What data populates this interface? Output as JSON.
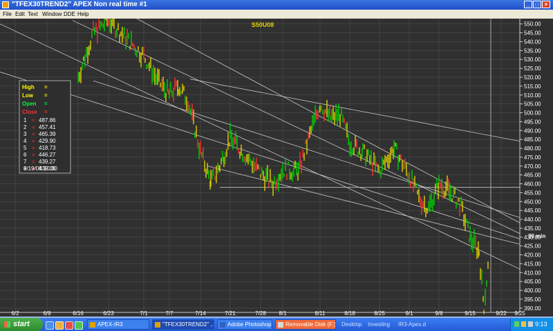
{
  "window": {
    "title": "\"TFEX30TREND2\" APEX Non real time #1"
  },
  "menu": [
    "File",
    "Edit",
    "Text",
    "Window",
    "DDE",
    "Help"
  ],
  "chart": {
    "symbol": "S50U08",
    "period_label": "30 min",
    "y_ticks": [
      390,
      395,
      400,
      405,
      410,
      415,
      420,
      425,
      430,
      435,
      440,
      445,
      450,
      455,
      460,
      465,
      470,
      475,
      480,
      485,
      490,
      495,
      500,
      505,
      510,
      515,
      520,
      525,
      530,
      535,
      540,
      545,
      550
    ],
    "x_labels": [
      "6/2",
      "6/9",
      "6/16",
      "6/23",
      "7/1",
      "7/7",
      "7/14",
      "7/21",
      "7/28",
      "8/1",
      "8/11",
      "8/18",
      "8/25",
      "9/1",
      "9/8",
      "9/15",
      "9/22",
      "9/25"
    ],
    "info_box": {
      "rows": [
        {
          "label": "High",
          "value": "=",
          "color": "#ffff00"
        },
        {
          "label": "Low",
          "value": "=",
          "color": "#ffff00"
        },
        {
          "label": "Open",
          "value": "=",
          "color": "#00ff40"
        },
        {
          "label": "Close",
          "value": "=",
          "color": "#ff3030"
        }
      ],
      "lines": [
        {
          "n": "1",
          "value": "487.86"
        },
        {
          "n": "2",
          "value": "457.41"
        },
        {
          "n": "3",
          "value": "465.39"
        },
        {
          "n": "4",
          "value": "429.90"
        },
        {
          "n": "5",
          "value": "418.73"
        },
        {
          "n": "6",
          "value": "446.27"
        },
        {
          "n": "7",
          "value": "439.27"
        },
        {
          "n": "8",
          "value": "439.28"
        }
      ],
      "timestamp": "9/19/08  10:30"
    },
    "colors": {
      "background": "#303030",
      "grid": "#555555",
      "bar_up": "#00d000",
      "bar_down": "#ff3030",
      "bar_neutral": "#e0d000",
      "trend": "#c8c8c8"
    }
  },
  "chart_data": {
    "type": "candlestick",
    "title": "S50U08",
    "ylim": [
      388,
      553
    ],
    "price_path": [
      {
        "x": "6/16",
        "y": 520
      },
      {
        "x": "6/20",
        "y": 545
      },
      {
        "x": "6/23",
        "y": 552
      },
      {
        "x": "6/26",
        "y": 543
      },
      {
        "x": "7/1",
        "y": 532
      },
      {
        "x": "7/4",
        "y": 518
      },
      {
        "x": "7/7",
        "y": 510
      },
      {
        "x": "7/9",
        "y": 515
      },
      {
        "x": "7/11",
        "y": 507
      },
      {
        "x": "7/14",
        "y": 478
      },
      {
        "x": "7/16",
        "y": 461
      },
      {
        "x": "7/18",
        "y": 470
      },
      {
        "x": "7/21",
        "y": 486
      },
      {
        "x": "7/24",
        "y": 476
      },
      {
        "x": "7/28",
        "y": 466
      },
      {
        "x": "7/31",
        "y": 460
      },
      {
        "x": "8/1",
        "y": 468
      },
      {
        "x": "8/5",
        "y": 467
      },
      {
        "x": "8/8",
        "y": 490
      },
      {
        "x": "8/11",
        "y": 505
      },
      {
        "x": "8/13",
        "y": 497
      },
      {
        "x": "8/16",
        "y": 499
      },
      {
        "x": "8/18",
        "y": 483
      },
      {
        "x": "8/21",
        "y": 478
      },
      {
        "x": "8/25",
        "y": 467
      },
      {
        "x": "8/27",
        "y": 480
      },
      {
        "x": "9/1",
        "y": 465
      },
      {
        "x": "9/3",
        "y": 452
      },
      {
        "x": "9/5",
        "y": 446
      },
      {
        "x": "9/8",
        "y": 460
      },
      {
        "x": "9/10",
        "y": 456
      },
      {
        "x": "9/12",
        "y": 449
      },
      {
        "x": "9/15",
        "y": 430
      },
      {
        "x": "9/17",
        "y": 422
      },
      {
        "x": "9/18",
        "y": 391
      },
      {
        "x": "9/19",
        "y": 420
      }
    ]
  },
  "taskbar": {
    "start_label": "start",
    "items": [
      {
        "label": "APEX-IR3",
        "active": false,
        "highlight": false
      },
      {
        "label": "\"TFEX30TREND2\" ...",
        "active": true,
        "highlight": false
      },
      {
        "label": "Adobe Photoshop",
        "active": false,
        "highlight": false
      },
      {
        "label": "Removable Disk (F:)",
        "active": false,
        "highlight": true
      }
    ],
    "toolbar_text": [
      "Desktop",
      "Investing",
      "IR3-Apex.d"
    ],
    "clock": "9:13"
  }
}
